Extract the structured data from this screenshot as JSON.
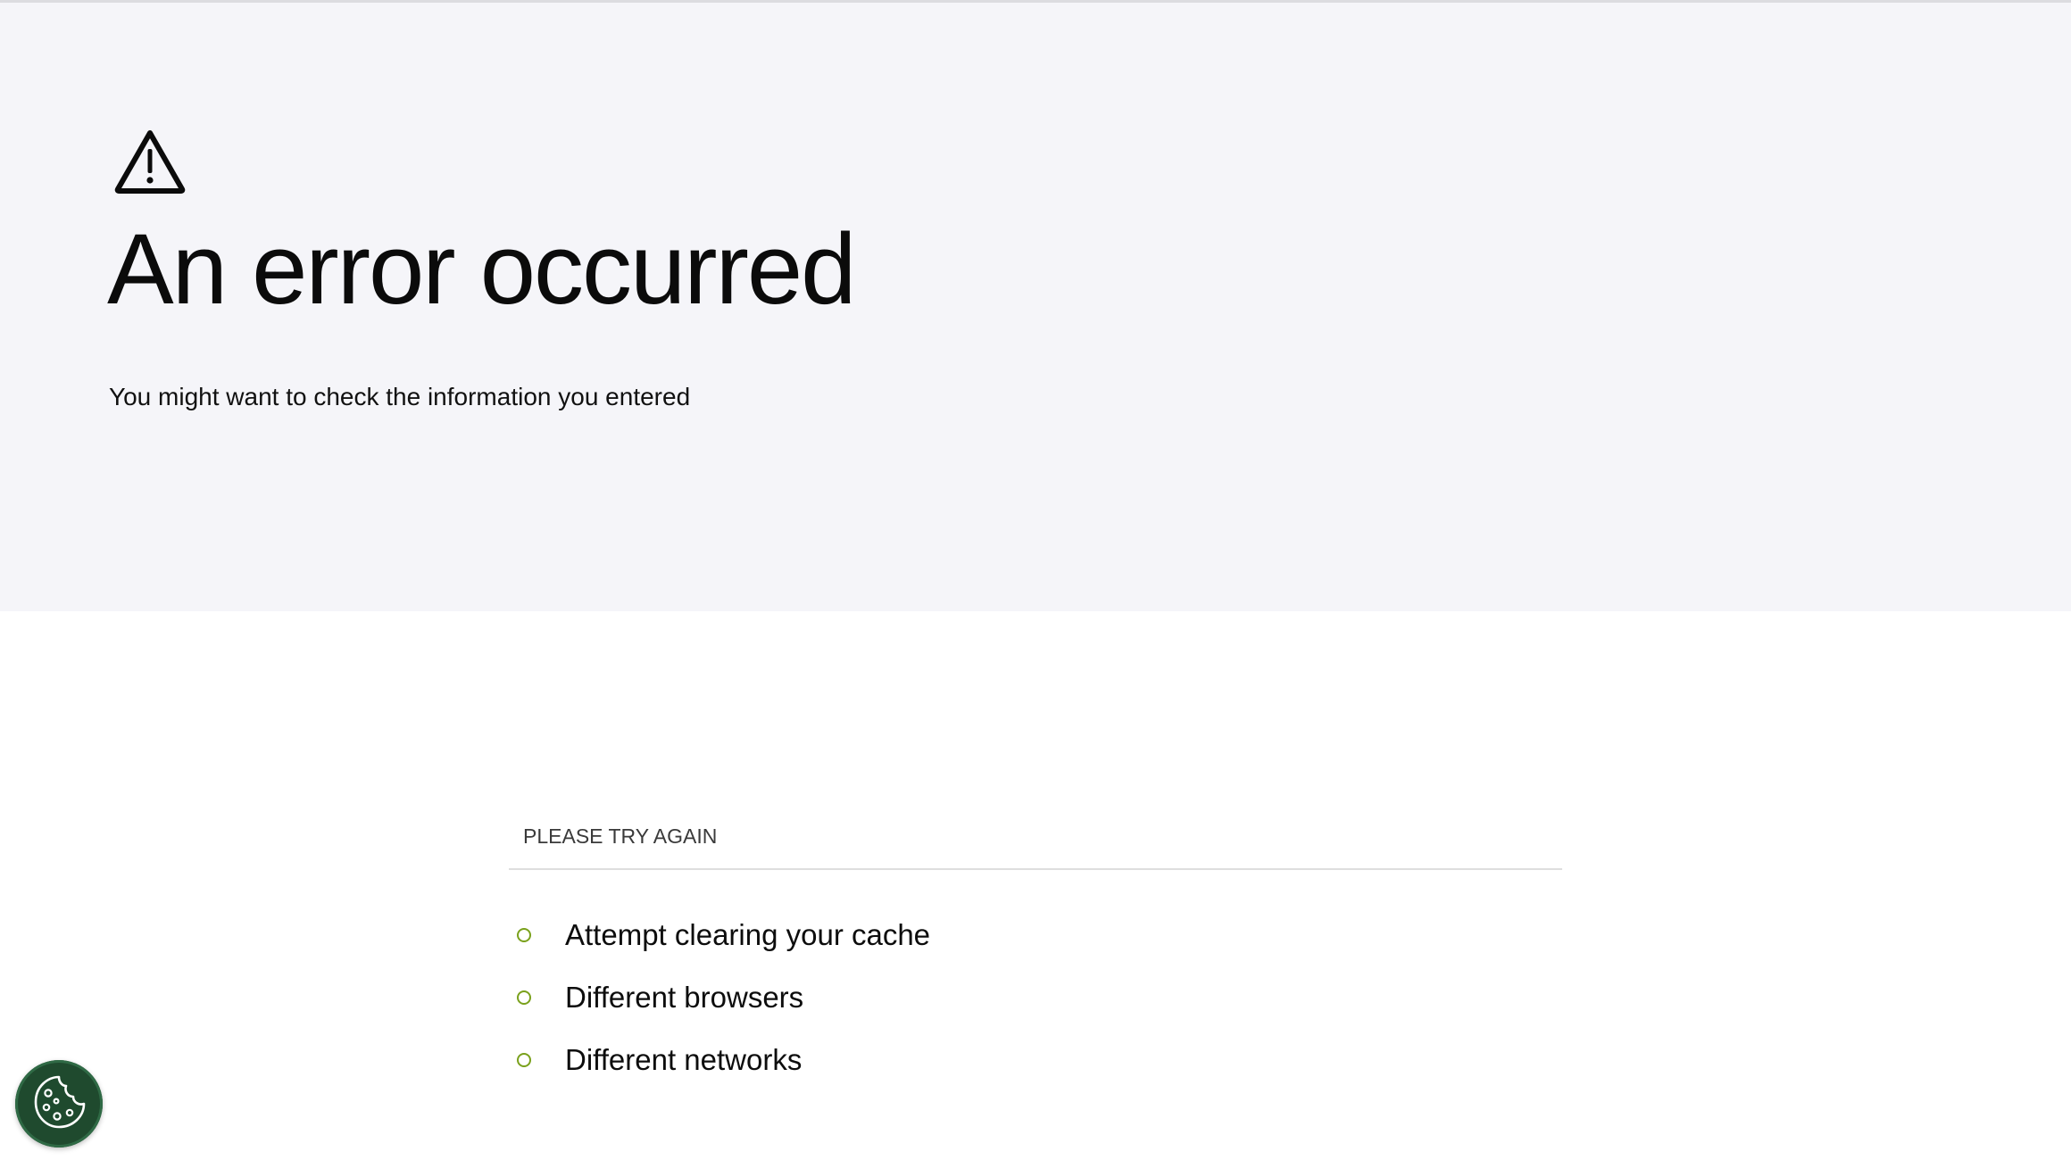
{
  "hero": {
    "icon": "warning-icon",
    "title": "An error occurred",
    "subtitle": "You might want to check the information you entered"
  },
  "tips": {
    "heading": "PLEASE TRY AGAIN",
    "items": [
      "Attempt clearing your cache",
      "Different browsers",
      "Different networks"
    ]
  },
  "cookie_button": {
    "icon": "cookie-icon",
    "color": "#1f4a2e"
  },
  "colors": {
    "hero_background": "#f5f5f9",
    "bullet_accent": "#7aa11c"
  }
}
